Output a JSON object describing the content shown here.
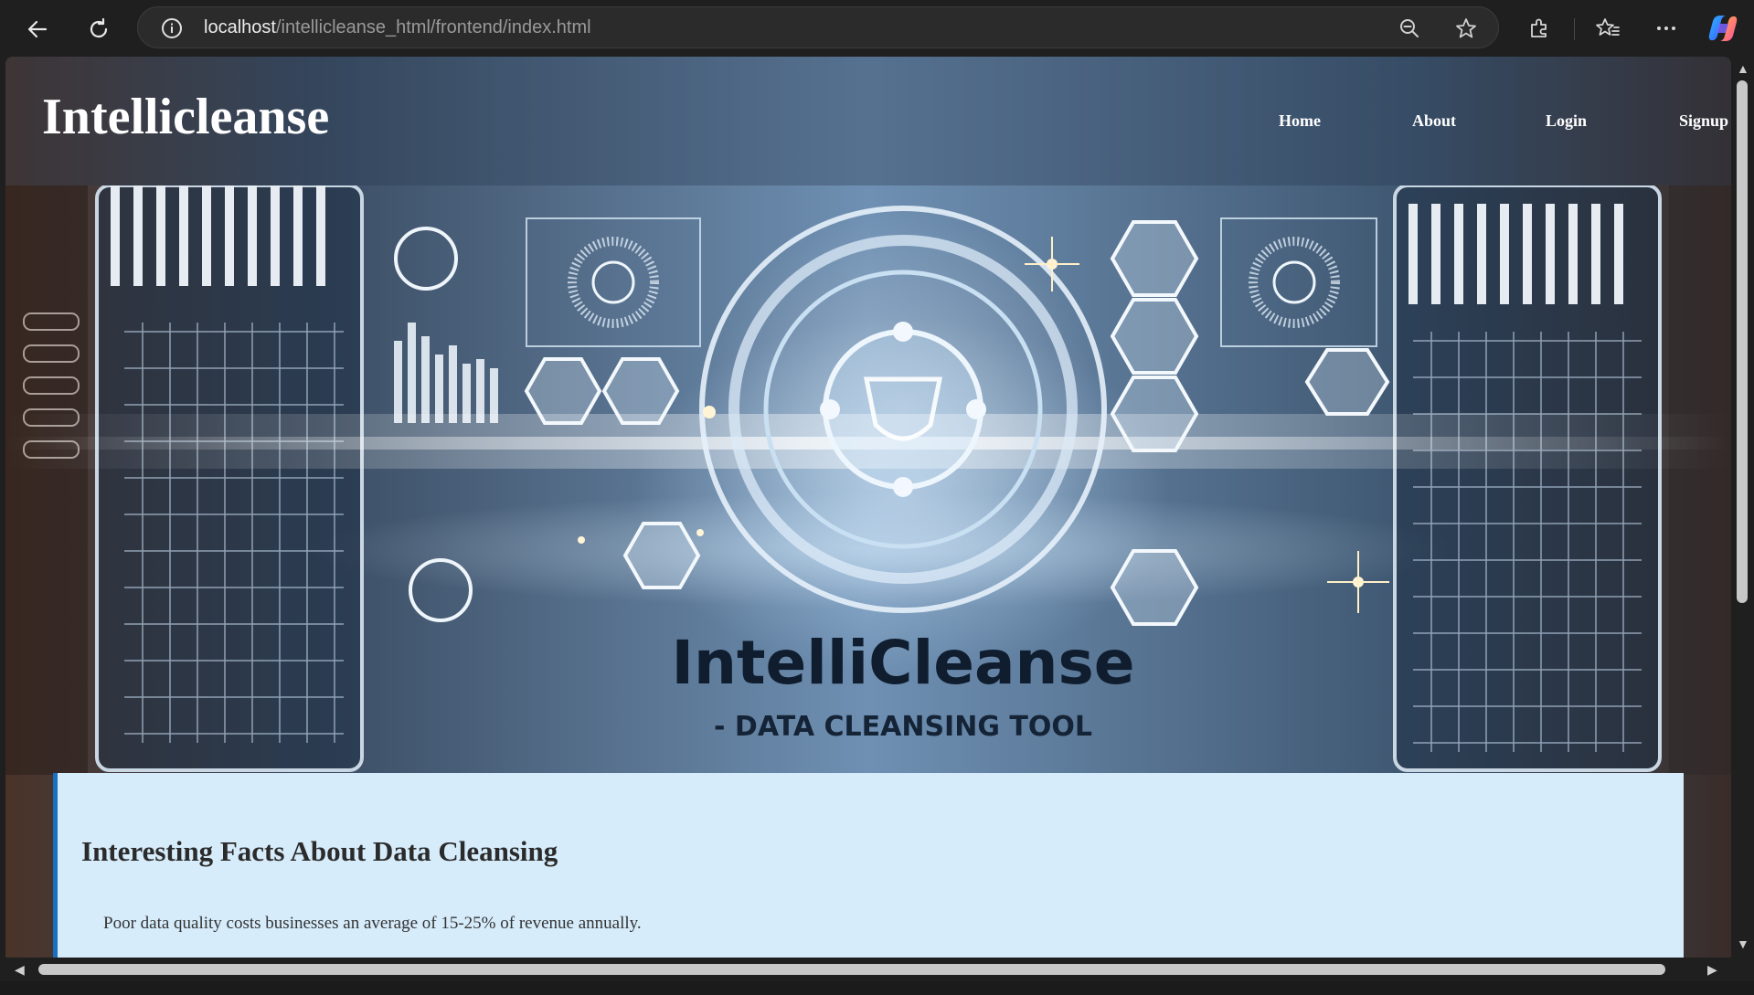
{
  "browser": {
    "url_host": "localhost",
    "url_path": "/intellicleanse_html/frontend/index.html",
    "icons": {
      "back": "back-arrow-icon",
      "refresh": "refresh-icon",
      "site_info": "info-icon",
      "zoom": "zoom-out-icon",
      "favorite": "star-icon",
      "extensions": "puzzle-icon",
      "favorites_list": "favorites-icon",
      "menu": "more-icon",
      "copilot": "copilot-icon"
    }
  },
  "site": {
    "logo": "Intellicleanse",
    "nav": [
      "Home",
      "About",
      "Login",
      "Signup"
    ]
  },
  "hero": {
    "brand": "IntelliCleanse",
    "tagline": "- DATA CLEANSING TOOL"
  },
  "facts": {
    "title": "Interesting Facts About Data Cleansing",
    "items": [
      "Poor data quality costs businesses an average of 15-25% of revenue annually."
    ]
  },
  "colors": {
    "header_bg": "#1f1f1f",
    "facts_bg": "#d6ecfb",
    "facts_accent": "#1a6fc0",
    "hero_glow": "#dfeffc"
  }
}
